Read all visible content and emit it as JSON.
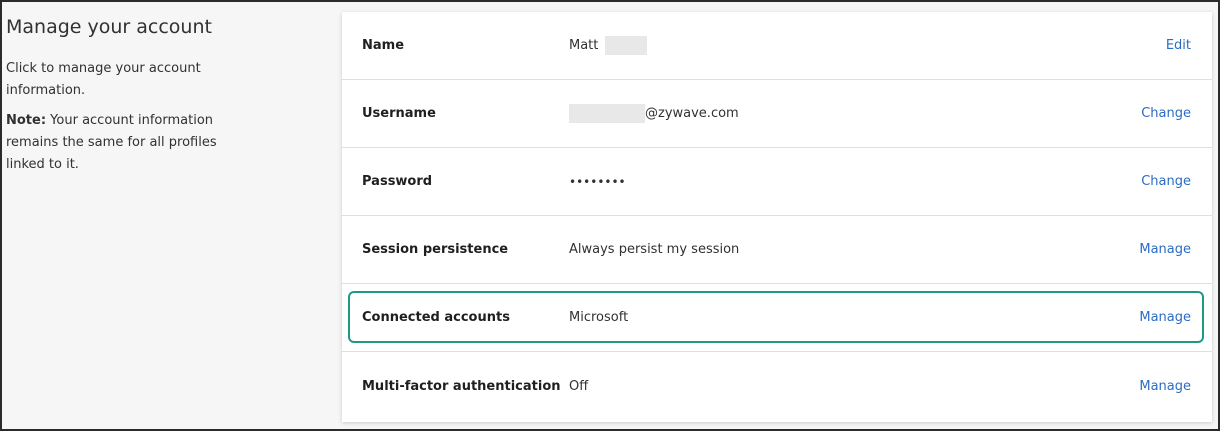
{
  "sidebar": {
    "title": "Manage your account",
    "intro": "Click to manage your account information.",
    "note_label": "Note:",
    "note_text": " Your account information remains the same for all profiles linked to it."
  },
  "rows": [
    {
      "label": "Name",
      "value": "Matt",
      "action": "Edit"
    },
    {
      "label": "Username",
      "value": "@zywave.com",
      "action": "Change"
    },
    {
      "label": "Password",
      "value": "••••••••",
      "action": "Change"
    },
    {
      "label": "Session persistence",
      "value": "Always persist my session",
      "action": "Manage"
    },
    {
      "label": "Connected accounts",
      "value": "Microsoft",
      "action": "Manage"
    },
    {
      "label": "Multi-factor authentication",
      "value": "Off",
      "action": "Manage"
    }
  ],
  "colors": {
    "link": "#2b6cc4",
    "highlight_border": "#1e9a84"
  }
}
